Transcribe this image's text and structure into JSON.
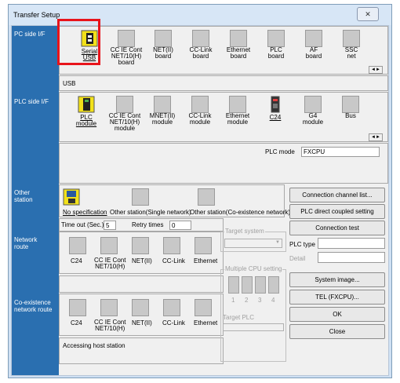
{
  "window": {
    "title": "Transfer Setup",
    "close_glyph": "✕"
  },
  "pc_side": {
    "label": "PC side I/F",
    "items": [
      "Serial\nUSB",
      "CC IE Cont\nNET/10(H)\nboard",
      "NET(II)\nboard",
      "CC-Link\nboard",
      "Ethernet\nboard",
      "PLC\nboard",
      "AF\nboard",
      "SSC\nnet"
    ],
    "selected_text": "USB"
  },
  "plc_side": {
    "label": "PLC side I/F",
    "items": [
      "PLC\nmodule",
      "CC IE Cont\nNET/10(H)\nmodule",
      "MNET(II)\nmodule",
      "CC-Link\nmodule",
      "Ethernet\nmodule",
      "C24",
      "G4\nmodule",
      "Bus"
    ],
    "plc_mode_label": "PLC mode",
    "plc_mode_value": "FXCPU"
  },
  "other_station": {
    "label": "Other\nstation",
    "items": [
      "No specification",
      "Other station(Single network)",
      "Other station(Co-existence network)"
    ],
    "timeout_label": "Time out (Sec.)",
    "timeout_value": "5",
    "retry_label": "Retry times",
    "retry_value": "0"
  },
  "network_route": {
    "label": "Network\nroute",
    "items": [
      "C24",
      "CC IE Cont\nNET/10(H)",
      "NET(II)",
      "CC-Link",
      "Ethernet"
    ]
  },
  "coexistence_route": {
    "label": "Co-existence\nnetwork route",
    "items": [
      "C24",
      "CC IE Cont\nNET/10(H)",
      "NET(II)",
      "CC-Link",
      "Ethernet"
    ]
  },
  "target_system": {
    "title": "Target system"
  },
  "multi_cpu": {
    "title": "Multiple CPU setting",
    "numbers": [
      "1",
      "2",
      "3",
      "4"
    ],
    "target_plc_label": "Target PLC"
  },
  "plc_type": {
    "label": "PLC type",
    "detail_label": "Detail"
  },
  "buttons": {
    "connection_channel": "Connection channel list...",
    "plc_direct": "PLC direct coupled setting",
    "connection_test": "Connection test",
    "system_image": "System image...",
    "tel": "TEL (FXCPU)...",
    "ok": "OK",
    "close": "Close"
  },
  "status_text": "Accessing host station",
  "scroll_glyphs": {
    "left": "◄",
    "right": "►",
    "dropdown": "▼"
  },
  "colors": {
    "highlight_red": "#e8141b",
    "section_blue": "#2a6fb0"
  }
}
